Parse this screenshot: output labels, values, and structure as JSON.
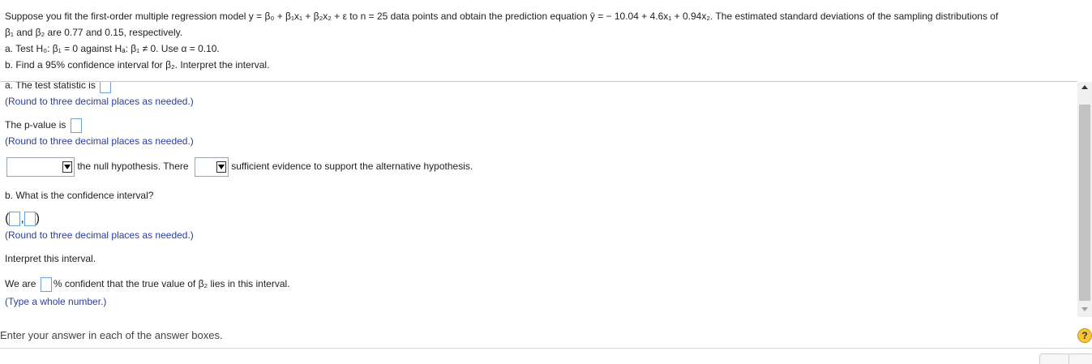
{
  "question": {
    "line1": "Suppose you fit the first-order multiple regression model y = β₀ + β₁x₁ + β₂x₂ + ε to n = 25 data points and obtain the prediction equation ŷ = − 10.04 + 4.6x₁ + 0.94x₂. The estimated standard deviations of the sampling distributions of",
    "line2": "β₁ and β₂ are 0.77 and 0.15, respectively.",
    "part_a": "a. Test H₀: β₁ = 0 against Hₐ: β₁ ≠ 0. Use α = 0.10.",
    "part_b": "b. Find a 95% confidence interval for β₂. Interpret the interval."
  },
  "answers": {
    "test_statistic_label": "a. The test statistic is",
    "test_statistic_hint": "(Round to three decimal places as needed.)",
    "pvalue_label": "The p-value is",
    "pvalue_hint": "(Round to three decimal places as needed.)",
    "decision_text1": "the null hypothesis. There",
    "decision_text2": "sufficient evidence to support the alternative hypothesis.",
    "ci_question": "b. What is the confidence interval?",
    "ci_open": "(",
    "ci_close": ")",
    "ci_hint": "(Round to three decimal places as needed.)",
    "interpret_label": "Interpret this interval.",
    "confidence_prefix": "We are",
    "confidence_suffix": "% confident that the true value of β₂ lies in this interval.",
    "confidence_hint": "(Type a whole number.)"
  },
  "footer": {
    "instruction": "Enter your answer in each of the answer boxes.",
    "help_symbol": "?"
  },
  "colors": {
    "hint": "#2a3d9c",
    "input_border": "#6aa0d8",
    "help_icon": "#f5c53a"
  }
}
